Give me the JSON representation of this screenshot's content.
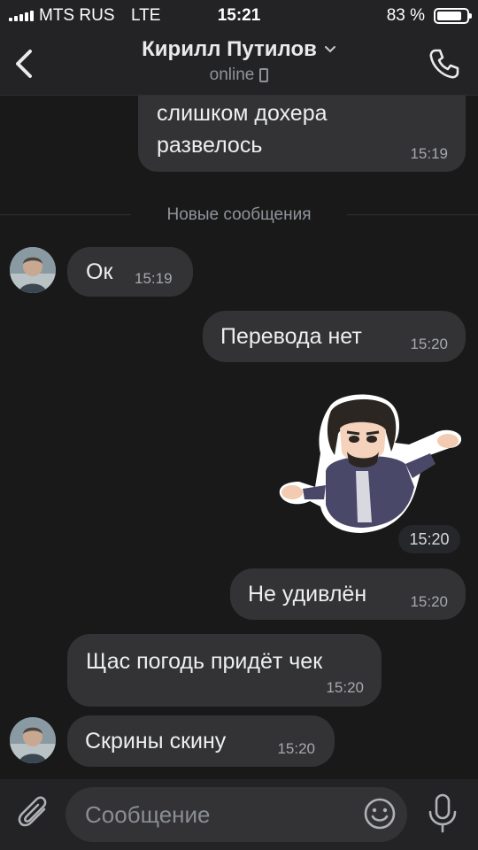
{
  "status_bar": {
    "carrier": "MTS RUS",
    "network": "LTE",
    "time": "15:21",
    "battery_percent": "83 %",
    "battery_level": 0.83
  },
  "header": {
    "contact_name": "Кирилл Путилов",
    "status": "online",
    "icons": [
      "back-arrow-icon",
      "chevron-down-icon",
      "mobile-phone-icon",
      "phone-call-icon"
    ]
  },
  "chat": {
    "new_messages_label": "Новые сообщения",
    "messages": [
      {
        "direction": "out",
        "text_line1": "слишком дохера",
        "text_line2": "развелось",
        "time": "15:19"
      },
      {
        "direction": "in",
        "text": "Ок",
        "time": "15:19"
      },
      {
        "direction": "out",
        "text": "Перевода нет",
        "time": "15:20"
      },
      {
        "direction": "out",
        "type": "sticker",
        "time": "15:20"
      },
      {
        "direction": "out",
        "text": "Не удивлён",
        "time": "15:20"
      },
      {
        "direction": "in",
        "text": "Щас погодь придёт чек",
        "time": "15:20"
      },
      {
        "direction": "in",
        "text": "Скрины скину",
        "time": "15:20"
      }
    ]
  },
  "input": {
    "placeholder": "Сообщение",
    "icons": [
      "paperclip-icon",
      "emoji-icon",
      "microphone-icon"
    ]
  },
  "colors": {
    "background": "#19191a",
    "bar": "#232325",
    "bubble": "#333335",
    "text": "#eceef0",
    "muted": "#8f9399"
  }
}
